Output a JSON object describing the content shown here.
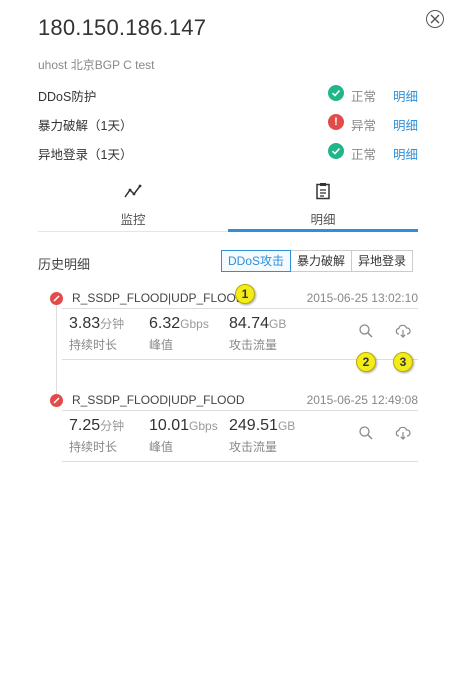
{
  "header": {
    "ip": "180.150.186.147",
    "subtitle": "uhost 北京BGP C test"
  },
  "status": [
    {
      "label": "DDoS防护",
      "state": "ok",
      "state_text": "正常",
      "detail": "明细"
    },
    {
      "label": "暴力破解（1天）",
      "state": "warn",
      "state_text": "异常",
      "detail": "明细"
    },
    {
      "label": "异地登录（1天）",
      "state": "ok",
      "state_text": "正常",
      "detail": "明细"
    }
  ],
  "tabs": [
    {
      "label": "监控",
      "icon": "line-chart-icon",
      "active": false
    },
    {
      "label": "明细",
      "icon": "clipboard-icon",
      "active": true
    }
  ],
  "history": {
    "title": "历史明细",
    "filters": [
      "DDoS攻击",
      "暴力破解",
      "异地登录"
    ],
    "active_filter": "DDoS攻击"
  },
  "events": [
    {
      "type": "R_SSDP_FLOOD|UDP_FLOOD",
      "time": "2015-06-25 13:02:10",
      "duration": {
        "value": "3.83",
        "unit": "分钟",
        "label": "持续时长"
      },
      "peak": {
        "value": "6.32",
        "unit": "Gbps",
        "label": "峰值"
      },
      "traffic": {
        "value": "84.74",
        "unit": "GB",
        "label": "攻击流量"
      }
    },
    {
      "type": "R_SSDP_FLOOD|UDP_FLOOD",
      "time": "2015-06-25 12:49:08",
      "duration": {
        "value": "7.25",
        "unit": "分钟",
        "label": "持续时长"
      },
      "peak": {
        "value": "10.01",
        "unit": "Gbps",
        "label": "峰值"
      },
      "traffic": {
        "value": "249.51",
        "unit": "GB",
        "label": "攻击流量"
      }
    }
  ],
  "annotations": [
    "1",
    "2",
    "3"
  ],
  "colors": {
    "accent": "#2f8fd8",
    "ok": "#21b58a",
    "danger": "#e34b4b",
    "badge": "#f4ec18"
  }
}
